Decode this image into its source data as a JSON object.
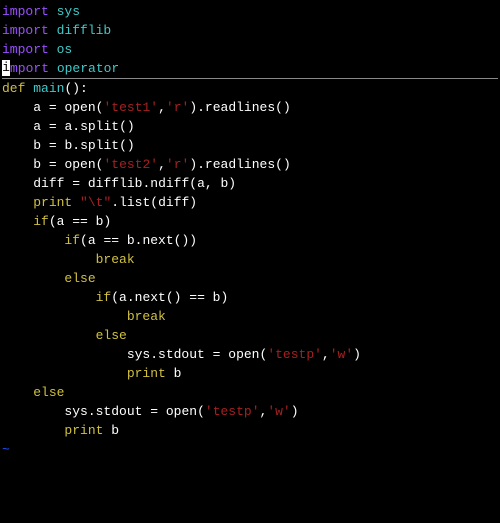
{
  "code": {
    "l1": {
      "kw": "import",
      "mod": "sys"
    },
    "l2": {
      "kw": "import",
      "mod": "difflib"
    },
    "l3": {
      "kw": "import",
      "mod": "os"
    },
    "l4": {
      "cursor": "i",
      "kw_rest": "mport",
      "mod": "operator"
    },
    "l5": {
      "kw": "def",
      "name": "main",
      "p1": "():"
    },
    "l6": {
      "indent": "    ",
      "lhs": "a ",
      "op": "=",
      "sp": " ",
      "fn": "open",
      "p1": "(",
      "s1": "'test1'",
      "c": ",",
      "s2": "'r'",
      "p2": ").",
      "m": "readlines",
      "p3": "()"
    },
    "l7": {
      "indent": "    ",
      "lhs": "a ",
      "op": "=",
      "sp": " ",
      "obj": "a.",
      "m": "split",
      "p": "()"
    },
    "l8": {
      "indent": "    ",
      "lhs": "b ",
      "op": "=",
      "sp": " ",
      "obj": "b.",
      "m": "split",
      "p": "()"
    },
    "l9": {
      "indent": "    ",
      "lhs": "b ",
      "op": "=",
      "sp": " ",
      "fn": "open",
      "p1": "(",
      "s1": "'test2'",
      "c": ",",
      "s2": "'r'",
      "p2": ").",
      "m": "readlines",
      "p3": "()"
    },
    "l10": {
      "indent": "    ",
      "lhs": "diff ",
      "op": "=",
      "sp": " ",
      "obj": "difflib.",
      "m": "ndiff",
      "p1": "(a, b)"
    },
    "l11": {
      "indent": "    ",
      "kw": "print",
      "sp": " ",
      "s": "\"\\t\"",
      "obj": ".",
      "m": "list",
      "p": "(diff)"
    },
    "l12": {
      "indent": "    ",
      "kw": "if",
      "p1": "(a ",
      "op": "==",
      "p2": " b)"
    },
    "l13": {
      "indent": "        ",
      "kw": "if",
      "p1": "(a ",
      "op": "==",
      "p2": " b.",
      "m": "next",
      "p3": "())"
    },
    "l14": {
      "indent": "            ",
      "kw": "break"
    },
    "l15": {
      "indent": "        ",
      "kw": "else"
    },
    "l16": {
      "indent": "            ",
      "kw": "if",
      "p1": "(a.",
      "m": "next",
      "p2": "() ",
      "op": "==",
      "p3": " b)"
    },
    "l17": {
      "indent": "                ",
      "kw": "break"
    },
    "l18": {
      "indent": "            ",
      "kw": "else"
    },
    "l19": {
      "indent": "                ",
      "obj": "sys.stdout ",
      "op": "=",
      "sp": " ",
      "fn": "open",
      "p1": "(",
      "s1": "'testp'",
      "c": ",",
      "s2": "'w'",
      "p2": ")"
    },
    "l20": {
      "indent": "                ",
      "kw": "print",
      "sp": " ",
      "id": "b"
    },
    "l21": {
      "indent": "    ",
      "kw": "else"
    },
    "l22": {
      "indent": "        ",
      "obj": "sys.stdout ",
      "op": "=",
      "sp": " ",
      "fn": "open",
      "p1": "(",
      "s1": "'testp'",
      "c": ",",
      "s2": "'w'",
      "p2": ")"
    },
    "l23": {
      "indent": "        ",
      "kw": "print",
      "sp": " ",
      "id": "b"
    },
    "tilde": "~"
  }
}
